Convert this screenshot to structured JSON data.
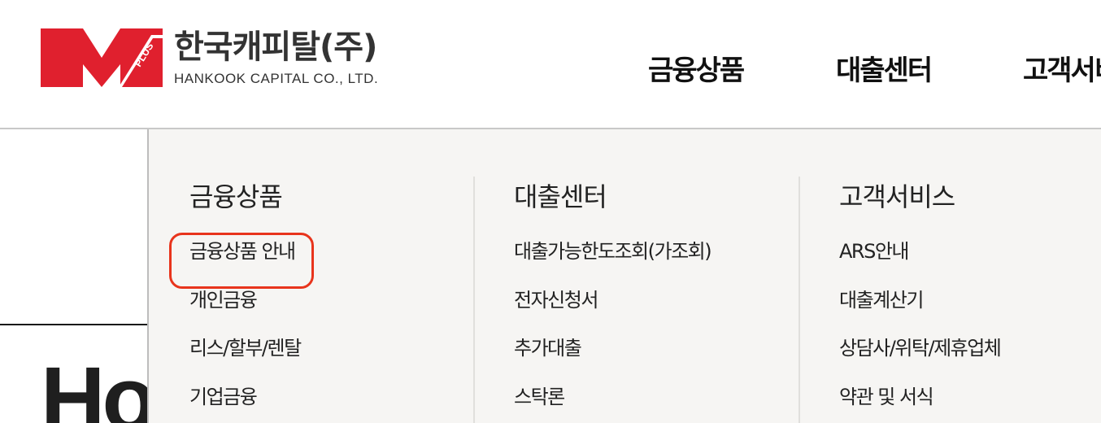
{
  "logo": {
    "mark_text": "PLUS",
    "name_kr": "한국캐피탈(주)",
    "name_en": "HANKOOK CAPITAL CO., LTD.",
    "colors": {
      "red": "#e0202e",
      "text": "#333333"
    }
  },
  "gnb": {
    "items": [
      "금융상품",
      "대출센터",
      "고객서비"
    ]
  },
  "page": {
    "heading_fragment": "Ho"
  },
  "mega_menu": {
    "columns": [
      {
        "title": "금융상품",
        "items": [
          "금융상품 안내",
          "개인금융",
          "리스/할부/렌탈",
          "기업금융"
        ]
      },
      {
        "title": "대출센터",
        "items": [
          "대출가능한도조회(가조회)",
          "전자신청서",
          "추가대출",
          "스탁론"
        ]
      },
      {
        "title": "고객서비스",
        "items": [
          "ARS안내",
          "대출계산기",
          "상담사/위탁/제휴업체",
          "약관 및 서식"
        ]
      }
    ],
    "highlighted_item": "금융상품 안내",
    "colors": {
      "background": "#f6f5f3",
      "highlight": "#e8341c"
    }
  }
}
